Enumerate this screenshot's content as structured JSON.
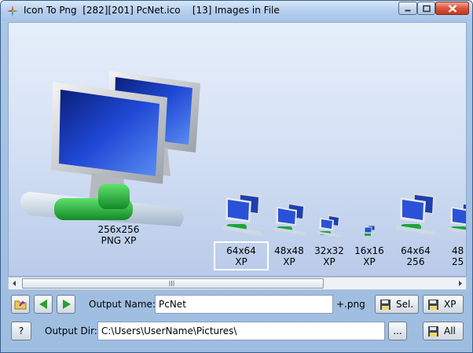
{
  "window": {
    "title": "Icon To Png  [282][201] PcNet.ico    [13] Images in File"
  },
  "title_buttons": {
    "minimize": "minimize-icon",
    "maximize": "maximize-icon",
    "close": "close-icon"
  },
  "images": [
    {
      "size": "256x256",
      "format": "PNG XP"
    },
    {
      "size": "64x64",
      "format": "XP",
      "selected": true
    },
    {
      "size": "48x48",
      "format": "XP"
    },
    {
      "size": "32x32",
      "format": "XP"
    },
    {
      "size": "16x16",
      "format": "XP"
    },
    {
      "size": "64x64",
      "format": "256"
    },
    {
      "size": "48",
      "format": "25"
    }
  ],
  "controls": {
    "output_name_label": "Output Name:",
    "output_name_value": "PcNet",
    "extension_label": "+.png",
    "output_dir_label": "Output Dir:",
    "output_dir_value": "C:\\Users\\UserName\\Pictures\\",
    "browse_label": "...",
    "help_label": "?",
    "save_sel_label": "Sel.",
    "save_xp_label": "XP",
    "save_all_label": "All"
  },
  "colors": {
    "nav_green": "#2e9d2e",
    "monitor_blue": "#1e3fb0",
    "connector_green": "#1ea53a"
  }
}
